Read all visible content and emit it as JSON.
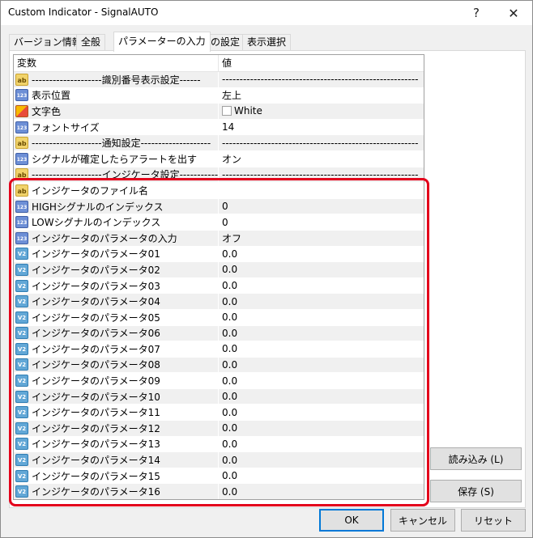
{
  "window": {
    "title": "Custom Indicator - SignalAUTO",
    "help_glyph": "?",
    "close_glyph": "✕"
  },
  "tabs": [
    {
      "label": "バージョン情報",
      "active": false
    },
    {
      "label": "全般",
      "active": false
    },
    {
      "label": "パラメーターの入力",
      "active": true
    },
    {
      "label": "色の設定",
      "active": false
    },
    {
      "label": "表示選択",
      "active": false
    }
  ],
  "grid": {
    "header_variable": "変数",
    "header_value": "値",
    "rows": [
      {
        "icon": "ab",
        "name": "--------------------識別番号表示設定------",
        "value": "--------------------------------------------------------"
      },
      {
        "icon": "num",
        "name": "表示位置",
        "value": "左上"
      },
      {
        "icon": "col",
        "name": "文字色",
        "value": "White"
      },
      {
        "icon": "num",
        "name": "フォントサイズ",
        "value": "14"
      },
      {
        "icon": "ab",
        "name": "--------------------通知設定--------------------",
        "value": "--------------------------------------------------------"
      },
      {
        "icon": "num",
        "name": "シグナルが確定したらアラートを出す",
        "value": "オン"
      },
      {
        "icon": "ab",
        "name": "--------------------インジケータ設定--------------",
        "value": "--------------------------------------------------------"
      },
      {
        "icon": "ab",
        "name": "インジケータのファイル名",
        "value": ""
      },
      {
        "icon": "num",
        "name": "HIGHシグナルのインデックス",
        "value": "0"
      },
      {
        "icon": "num",
        "name": "LOWシグナルのインデックス",
        "value": "0"
      },
      {
        "icon": "num",
        "name": "インジケータのパラメータの入力",
        "value": "オフ"
      },
      {
        "icon": "dbl",
        "name": "インジケータのパラメータ01",
        "value": "0.0"
      },
      {
        "icon": "dbl",
        "name": "インジケータのパラメータ02",
        "value": "0.0"
      },
      {
        "icon": "dbl",
        "name": "インジケータのパラメータ03",
        "value": "0.0"
      },
      {
        "icon": "dbl",
        "name": "インジケータのパラメータ04",
        "value": "0.0"
      },
      {
        "icon": "dbl",
        "name": "インジケータのパラメータ05",
        "value": "0.0"
      },
      {
        "icon": "dbl",
        "name": "インジケータのパラメータ06",
        "value": "0.0"
      },
      {
        "icon": "dbl",
        "name": "インジケータのパラメータ07",
        "value": "0.0"
      },
      {
        "icon": "dbl",
        "name": "インジケータのパラメータ08",
        "value": "0.0"
      },
      {
        "icon": "dbl",
        "name": "インジケータのパラメータ09",
        "value": "0.0"
      },
      {
        "icon": "dbl",
        "name": "インジケータのパラメータ10",
        "value": "0.0"
      },
      {
        "icon": "dbl",
        "name": "インジケータのパラメータ11",
        "value": "0.0"
      },
      {
        "icon": "dbl",
        "name": "インジケータのパラメータ12",
        "value": "0.0"
      },
      {
        "icon": "dbl",
        "name": "インジケータのパラメータ13",
        "value": "0.0"
      },
      {
        "icon": "dbl",
        "name": "インジケータのパラメータ14",
        "value": "0.0"
      },
      {
        "icon": "dbl",
        "name": "インジケータのパラメータ15",
        "value": "0.0"
      },
      {
        "icon": "dbl",
        "name": "インジケータのパラメータ16",
        "value": "0.0"
      }
    ]
  },
  "icon_labels": {
    "ab": "ab",
    "num": "123",
    "col": "",
    "dbl": "V2"
  },
  "buttons": {
    "load": "読み込み (L)",
    "save": "保存 (S)",
    "ok": "OK",
    "cancel": "キャンセル",
    "reset": "リセット"
  },
  "colors": {
    "highlight": "#e3001b",
    "ok_border": "#0078d7"
  }
}
